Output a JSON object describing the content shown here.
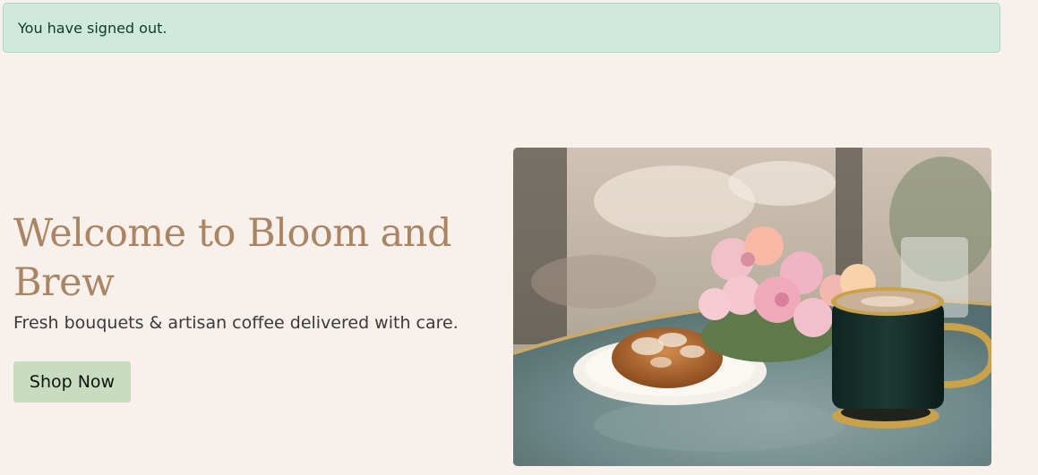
{
  "alert": {
    "message": "You have signed out."
  },
  "hero": {
    "title": "Welcome to Bloom and Brew",
    "subtitle": "Fresh bouquets & artisan coffee delivered with care.",
    "cta_label": "Shop Now",
    "image_icon": "cafe-photo"
  },
  "colors": {
    "page_background": "#f8f0eb",
    "alert_background": "#cfe9dd",
    "title_color": "#a98564",
    "button_background": "#c8dcc0"
  }
}
